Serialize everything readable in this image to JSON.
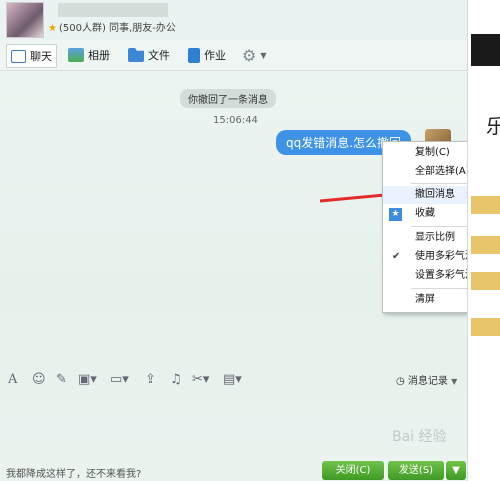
{
  "header": {
    "group_line": "(500人群) 同事,朋友-办公"
  },
  "toolbar": {
    "chat": "聊天",
    "album": "相册",
    "file": "文件",
    "work": "作业"
  },
  "chat": {
    "notice": "你撤回了一条消息",
    "time": "15:06:44",
    "message": "qq发错消息.怎么撤回"
  },
  "menu": {
    "copy": "复制(C)",
    "select_all": "全部选择(A)",
    "recall": "撤回消息",
    "favorite": "收藏",
    "zoom": "显示比例",
    "use_bubble": "使用多彩气泡",
    "set_bubble": "设置多彩气泡",
    "clear": "清屏"
  },
  "input": {
    "message_record": "消息记录"
  },
  "bottom": {
    "ad": "我都降成这样了，还不来看我?",
    "close": "关闭(C)",
    "send": "发送(S)"
  },
  "watermark": "Bai 经验",
  "right": {
    "char": "乐"
  },
  "colors": {
    "bubble": "#3e93e6",
    "arrow": "#e52a2a",
    "button": "#4caf2f"
  }
}
